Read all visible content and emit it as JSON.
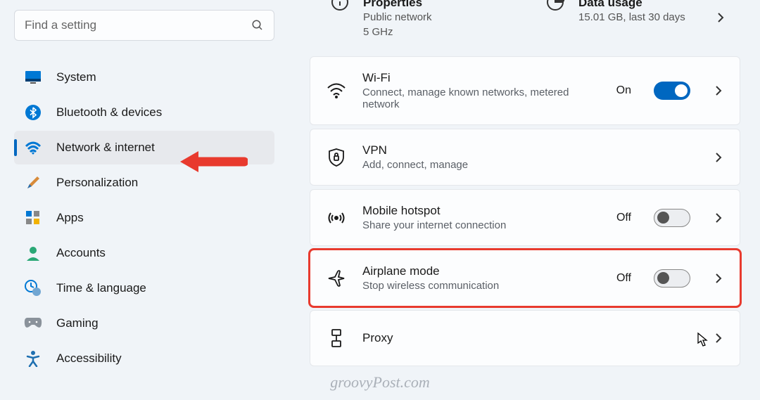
{
  "search": {
    "placeholder": "Find a setting"
  },
  "sidebar": {
    "items": [
      {
        "label": "System"
      },
      {
        "label": "Bluetooth & devices"
      },
      {
        "label": "Network & internet",
        "selected": true
      },
      {
        "label": "Personalization"
      },
      {
        "label": "Apps"
      },
      {
        "label": "Accounts"
      },
      {
        "label": "Time & language"
      },
      {
        "label": "Gaming"
      },
      {
        "label": "Accessibility"
      }
    ]
  },
  "top": {
    "properties": {
      "title": "Properties",
      "line1": "Public network",
      "line2": "5 GHz"
    },
    "data_usage": {
      "title": "Data usage",
      "line1": "15.01 GB, last 30 days"
    }
  },
  "cards": {
    "wifi": {
      "title": "Wi-Fi",
      "sub": "Connect, manage known networks, metered network",
      "state": "On"
    },
    "vpn": {
      "title": "VPN",
      "sub": "Add, connect, manage"
    },
    "hotspot": {
      "title": "Mobile hotspot",
      "sub": "Share your internet connection",
      "state": "Off"
    },
    "airplane": {
      "title": "Airplane mode",
      "sub": "Stop wireless communication",
      "state": "Off"
    },
    "proxy": {
      "title": "Proxy",
      "sub": ""
    }
  },
  "watermark": "groovyPost.com"
}
